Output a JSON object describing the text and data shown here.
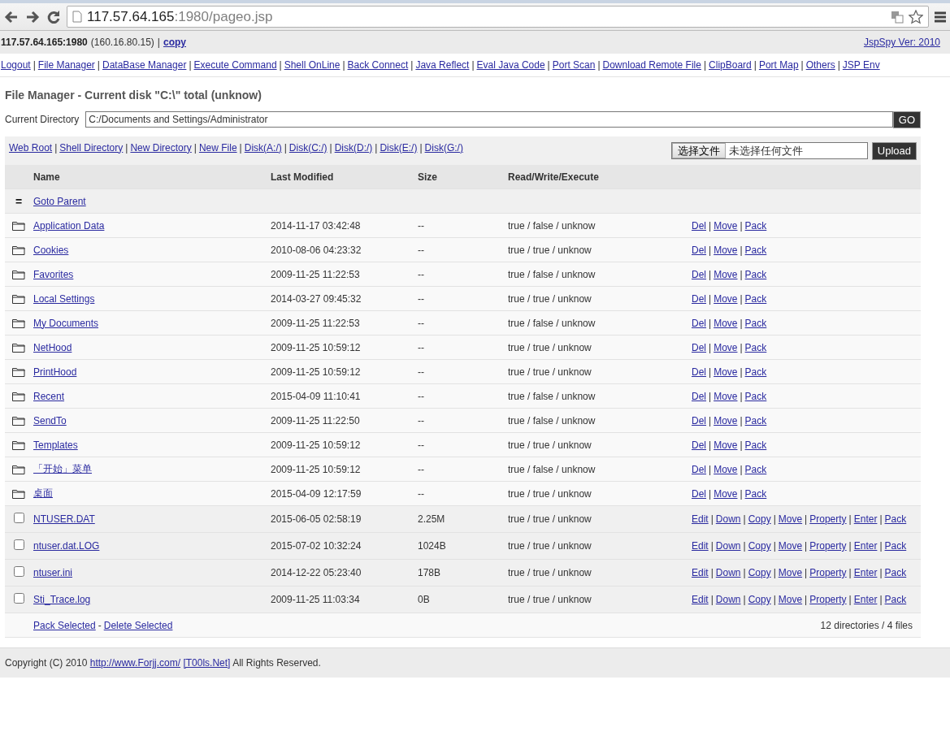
{
  "browser": {
    "url_host": "117.57.64.165",
    "url_path": ":1980/pageo.jsp"
  },
  "header": {
    "host": "117.57.64.165:1980",
    "ip": "(160.16.80.15)",
    "separator": "|",
    "copy": "copy",
    "version": "JspSpy Ver: 2010"
  },
  "nav": {
    "separator": "|",
    "links": [
      "Logout",
      "File Manager",
      "DataBase Manager",
      "Execute Command",
      "Shell OnLine",
      "Back Connect",
      "Java Reflect",
      "Eval Java Code",
      "Port Scan",
      "Download Remote File",
      "ClipBoard",
      "Port Map",
      "Others",
      "JSP Env"
    ]
  },
  "file_manager": {
    "title": "File Manager - Current disk \"C:\\\" total (unknow)",
    "current_directory": {
      "label": "Current Directory",
      "value": "C:/Documents and Settings/Administrator",
      "button": "GO"
    },
    "toolbar": {
      "separator": "|",
      "links": [
        "Web Root",
        "Shell Directory",
        "New Directory",
        "New File",
        "Disk(A:/)",
        "Disk(C:/)",
        "Disk(D:/)",
        "Disk(E:/)",
        "Disk(G:/)"
      ]
    },
    "upload": {
      "choose_button": "选择文件",
      "status": "未选择任何文件",
      "button": "Upload"
    },
    "table": {
      "columns": [
        "Name",
        "Last Modified",
        "Size",
        "Read/Write/Execute"
      ],
      "parent": {
        "icon": "=",
        "label": "Goto Parent"
      },
      "separator": "|",
      "rows": [
        {
          "kind": "dir",
          "name": "Application Data",
          "modified": "2014-11-17 03:42:48",
          "size": "--",
          "rwx": "true / false / unknow",
          "actions": [
            "Del",
            "Move",
            "Pack"
          ]
        },
        {
          "kind": "dir",
          "name": "Cookies",
          "modified": "2010-08-06 04:23:32",
          "size": "--",
          "rwx": "true / true / unknow",
          "actions": [
            "Del",
            "Move",
            "Pack"
          ]
        },
        {
          "kind": "dir",
          "name": "Favorites",
          "modified": "2009-11-25 11:22:53",
          "size": "--",
          "rwx": "true / false / unknow",
          "actions": [
            "Del",
            "Move",
            "Pack"
          ]
        },
        {
          "kind": "dir",
          "name": "Local Settings",
          "modified": "2014-03-27 09:45:32",
          "size": "--",
          "rwx": "true / true / unknow",
          "actions": [
            "Del",
            "Move",
            "Pack"
          ]
        },
        {
          "kind": "dir",
          "name": "My Documents",
          "modified": "2009-11-25 11:22:53",
          "size": "--",
          "rwx": "true / false / unknow",
          "actions": [
            "Del",
            "Move",
            "Pack"
          ]
        },
        {
          "kind": "dir",
          "name": "NetHood",
          "modified": "2009-11-25 10:59:12",
          "size": "--",
          "rwx": "true / true / unknow",
          "actions": [
            "Del",
            "Move",
            "Pack"
          ]
        },
        {
          "kind": "dir",
          "name": "PrintHood",
          "modified": "2009-11-25 10:59:12",
          "size": "--",
          "rwx": "true / true / unknow",
          "actions": [
            "Del",
            "Move",
            "Pack"
          ]
        },
        {
          "kind": "dir",
          "name": "Recent",
          "modified": "2015-04-09 11:10:41",
          "size": "--",
          "rwx": "true / false / unknow",
          "actions": [
            "Del",
            "Move",
            "Pack"
          ]
        },
        {
          "kind": "dir",
          "name": "SendTo",
          "modified": "2009-11-25 11:22:50",
          "size": "--",
          "rwx": "true / false / unknow",
          "actions": [
            "Del",
            "Move",
            "Pack"
          ]
        },
        {
          "kind": "dir",
          "name": "Templates",
          "modified": "2009-11-25 10:59:12",
          "size": "--",
          "rwx": "true / true / unknow",
          "actions": [
            "Del",
            "Move",
            "Pack"
          ]
        },
        {
          "kind": "dir",
          "name": "「开始」菜单",
          "modified": "2009-11-25 10:59:12",
          "size": "--",
          "rwx": "true / false / unknow",
          "actions": [
            "Del",
            "Move",
            "Pack"
          ]
        },
        {
          "kind": "dir",
          "name": "桌面",
          "modified": "2015-04-09 12:17:59",
          "size": "--",
          "rwx": "true / true / unknow",
          "actions": [
            "Del",
            "Move",
            "Pack"
          ]
        },
        {
          "kind": "file",
          "checked": false,
          "name": "NTUSER.DAT",
          "modified": "2015-06-05 02:58:19",
          "size": "2.25M",
          "rwx": "true / true / unknow",
          "actions": [
            "Edit",
            "Down",
            "Copy",
            "Move",
            "Property",
            "Enter",
            "Pack"
          ]
        },
        {
          "kind": "file",
          "checked": false,
          "name": "ntuser.dat.LOG",
          "modified": "2015-07-02 10:32:24",
          "size": "1024B",
          "rwx": "true / true / unknow",
          "actions": [
            "Edit",
            "Down",
            "Copy",
            "Move",
            "Property",
            "Enter",
            "Pack"
          ]
        },
        {
          "kind": "file",
          "checked": false,
          "name": "ntuser.ini",
          "modified": "2014-12-22 05:23:40",
          "size": "178B",
          "rwx": "true / true / unknow",
          "actions": [
            "Edit",
            "Down",
            "Copy",
            "Move",
            "Property",
            "Enter",
            "Pack"
          ]
        },
        {
          "kind": "file",
          "checked": false,
          "name": "Sti_Trace.log",
          "modified": "2009-11-25 11:03:34",
          "size": "0B",
          "rwx": "true / true / unknow",
          "actions": [
            "Edit",
            "Down",
            "Copy",
            "Move",
            "Property",
            "Enter",
            "Pack"
          ]
        }
      ]
    },
    "footer_row": {
      "pack": "Pack Selected",
      "dash": "-",
      "delete": "Delete Selected",
      "summary": "12 directories / 4 files"
    }
  },
  "copyright": {
    "text": "Copyright (C) 2010",
    "site": "http://www.Forjj.com/",
    "team": "[T00ls.Net]",
    "rights": "All Rights Reserved."
  }
}
